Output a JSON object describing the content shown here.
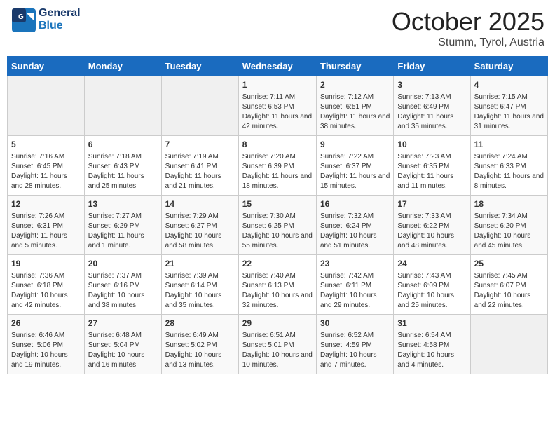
{
  "header": {
    "logo_general": "General",
    "logo_blue": "Blue",
    "title": "October 2025",
    "location": "Stumm, Tyrol, Austria"
  },
  "days_of_week": [
    "Sunday",
    "Monday",
    "Tuesday",
    "Wednesday",
    "Thursday",
    "Friday",
    "Saturday"
  ],
  "weeks": [
    [
      {
        "day": "",
        "info": ""
      },
      {
        "day": "",
        "info": ""
      },
      {
        "day": "",
        "info": ""
      },
      {
        "day": "1",
        "info": "Sunrise: 7:11 AM\nSunset: 6:53 PM\nDaylight: 11 hours and 42 minutes."
      },
      {
        "day": "2",
        "info": "Sunrise: 7:12 AM\nSunset: 6:51 PM\nDaylight: 11 hours and 38 minutes."
      },
      {
        "day": "3",
        "info": "Sunrise: 7:13 AM\nSunset: 6:49 PM\nDaylight: 11 hours and 35 minutes."
      },
      {
        "day": "4",
        "info": "Sunrise: 7:15 AM\nSunset: 6:47 PM\nDaylight: 11 hours and 31 minutes."
      }
    ],
    [
      {
        "day": "5",
        "info": "Sunrise: 7:16 AM\nSunset: 6:45 PM\nDaylight: 11 hours and 28 minutes."
      },
      {
        "day": "6",
        "info": "Sunrise: 7:18 AM\nSunset: 6:43 PM\nDaylight: 11 hours and 25 minutes."
      },
      {
        "day": "7",
        "info": "Sunrise: 7:19 AM\nSunset: 6:41 PM\nDaylight: 11 hours and 21 minutes."
      },
      {
        "day": "8",
        "info": "Sunrise: 7:20 AM\nSunset: 6:39 PM\nDaylight: 11 hours and 18 minutes."
      },
      {
        "day": "9",
        "info": "Sunrise: 7:22 AM\nSunset: 6:37 PM\nDaylight: 11 hours and 15 minutes."
      },
      {
        "day": "10",
        "info": "Sunrise: 7:23 AM\nSunset: 6:35 PM\nDaylight: 11 hours and 11 minutes."
      },
      {
        "day": "11",
        "info": "Sunrise: 7:24 AM\nSunset: 6:33 PM\nDaylight: 11 hours and 8 minutes."
      }
    ],
    [
      {
        "day": "12",
        "info": "Sunrise: 7:26 AM\nSunset: 6:31 PM\nDaylight: 11 hours and 5 minutes."
      },
      {
        "day": "13",
        "info": "Sunrise: 7:27 AM\nSunset: 6:29 PM\nDaylight: 11 hours and 1 minute."
      },
      {
        "day": "14",
        "info": "Sunrise: 7:29 AM\nSunset: 6:27 PM\nDaylight: 10 hours and 58 minutes."
      },
      {
        "day": "15",
        "info": "Sunrise: 7:30 AM\nSunset: 6:25 PM\nDaylight: 10 hours and 55 minutes."
      },
      {
        "day": "16",
        "info": "Sunrise: 7:32 AM\nSunset: 6:24 PM\nDaylight: 10 hours and 51 minutes."
      },
      {
        "day": "17",
        "info": "Sunrise: 7:33 AM\nSunset: 6:22 PM\nDaylight: 10 hours and 48 minutes."
      },
      {
        "day": "18",
        "info": "Sunrise: 7:34 AM\nSunset: 6:20 PM\nDaylight: 10 hours and 45 minutes."
      }
    ],
    [
      {
        "day": "19",
        "info": "Sunrise: 7:36 AM\nSunset: 6:18 PM\nDaylight: 10 hours and 42 minutes."
      },
      {
        "day": "20",
        "info": "Sunrise: 7:37 AM\nSunset: 6:16 PM\nDaylight: 10 hours and 38 minutes."
      },
      {
        "day": "21",
        "info": "Sunrise: 7:39 AM\nSunset: 6:14 PM\nDaylight: 10 hours and 35 minutes."
      },
      {
        "day": "22",
        "info": "Sunrise: 7:40 AM\nSunset: 6:13 PM\nDaylight: 10 hours and 32 minutes."
      },
      {
        "day": "23",
        "info": "Sunrise: 7:42 AM\nSunset: 6:11 PM\nDaylight: 10 hours and 29 minutes."
      },
      {
        "day": "24",
        "info": "Sunrise: 7:43 AM\nSunset: 6:09 PM\nDaylight: 10 hours and 25 minutes."
      },
      {
        "day": "25",
        "info": "Sunrise: 7:45 AM\nSunset: 6:07 PM\nDaylight: 10 hours and 22 minutes."
      }
    ],
    [
      {
        "day": "26",
        "info": "Sunrise: 6:46 AM\nSunset: 5:06 PM\nDaylight: 10 hours and 19 minutes."
      },
      {
        "day": "27",
        "info": "Sunrise: 6:48 AM\nSunset: 5:04 PM\nDaylight: 10 hours and 16 minutes."
      },
      {
        "day": "28",
        "info": "Sunrise: 6:49 AM\nSunset: 5:02 PM\nDaylight: 10 hours and 13 minutes."
      },
      {
        "day": "29",
        "info": "Sunrise: 6:51 AM\nSunset: 5:01 PM\nDaylight: 10 hours and 10 minutes."
      },
      {
        "day": "30",
        "info": "Sunrise: 6:52 AM\nSunset: 4:59 PM\nDaylight: 10 hours and 7 minutes."
      },
      {
        "day": "31",
        "info": "Sunrise: 6:54 AM\nSunset: 4:58 PM\nDaylight: 10 hours and 4 minutes."
      },
      {
        "day": "",
        "info": ""
      }
    ]
  ]
}
